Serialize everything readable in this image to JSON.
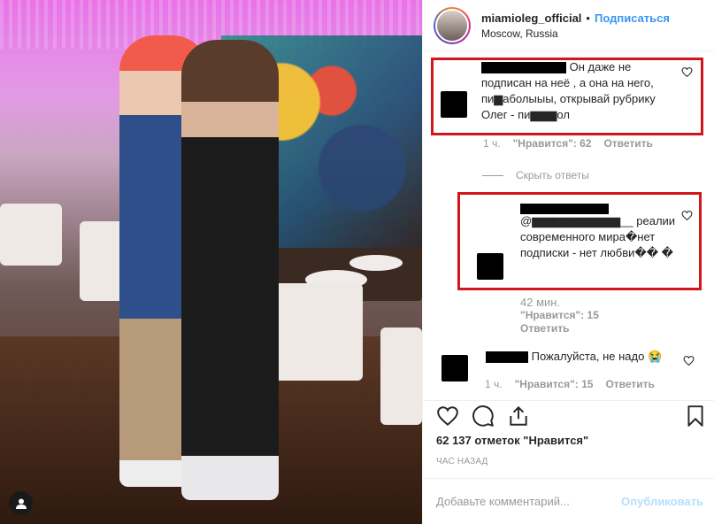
{
  "post": {
    "username": "miamioleg_official",
    "separator": "•",
    "follow_label": "Подписаться",
    "location": "Moscow, Russia"
  },
  "comments": [
    {
      "text": "Он даже не подписан на неё , а она на него, пи▆аболыыы, открывай рубрику Олег - пи▆▆▆ол",
      "time": "1 ч.",
      "likes": "\"Нравится\": 62",
      "reply": "Ответить"
    },
    {
      "mention": "@▆▆▆▆▆▆▆▆▆▆__",
      "text": "реалии современного мира�нет подписки - нет любви�� �",
      "time": "42 мин.",
      "likes": "\"Нравится\": 15",
      "reply": "Ответить"
    },
    {
      "text": "Пожалуйста, не надо 😭",
      "time": "1 ч.",
      "likes": "\"Нравится\": 15",
      "reply": "Ответить"
    }
  ],
  "hide_replies": "Скрыть ответы",
  "likes_count": "62 137 отметок \"Нравится\"",
  "time_ago": "ЧАС НАЗАД",
  "comment_box": {
    "placeholder": "Добавьте комментарий...",
    "publish_label": "Опубликовать"
  },
  "icons": [
    "heart-icon",
    "comment-icon",
    "share-icon",
    "bookmark-icon",
    "user-tag-icon"
  ],
  "colors": {
    "accent": "#3897f0",
    "highlight_box": "#d3161d",
    "meta_text": "#999999"
  }
}
